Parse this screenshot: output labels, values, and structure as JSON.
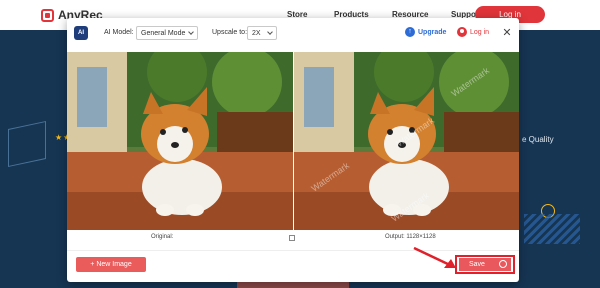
{
  "site": {
    "logo_text": "AnyRec",
    "nav": [
      "Store",
      "Products",
      "Resource",
      "Support"
    ],
    "login_label": "Log in",
    "background_stars": "★★★",
    "background_text": "e Quality"
  },
  "modal": {
    "app_icon_text": "AI",
    "model_label": "AI Model:",
    "model_value": "General Mode",
    "upscale_label": "Upscale to:",
    "upscale_value": "2X",
    "upgrade_label": "Upgrade",
    "login_label": "Log in",
    "close_glyph": "✕",
    "original_caption": "Original:",
    "output_caption": "Output: 1128×1128",
    "new_image_label": "+ New Image",
    "save_label": "Save",
    "watermark": "Watermark"
  },
  "colors": {
    "brand_red": "#e0353a",
    "page_bg": "#163553",
    "upgrade_blue": "#2d6cd6",
    "highlight_red": "#e0202a"
  },
  "icons": [
    "anyrec-logo-icon",
    "ai-app-icon",
    "chevron-down-icon",
    "upgrade-arrow-icon",
    "user-icon",
    "close-icon",
    "compare-icon",
    "clock-icon",
    "pointer-arrow-icon"
  ]
}
